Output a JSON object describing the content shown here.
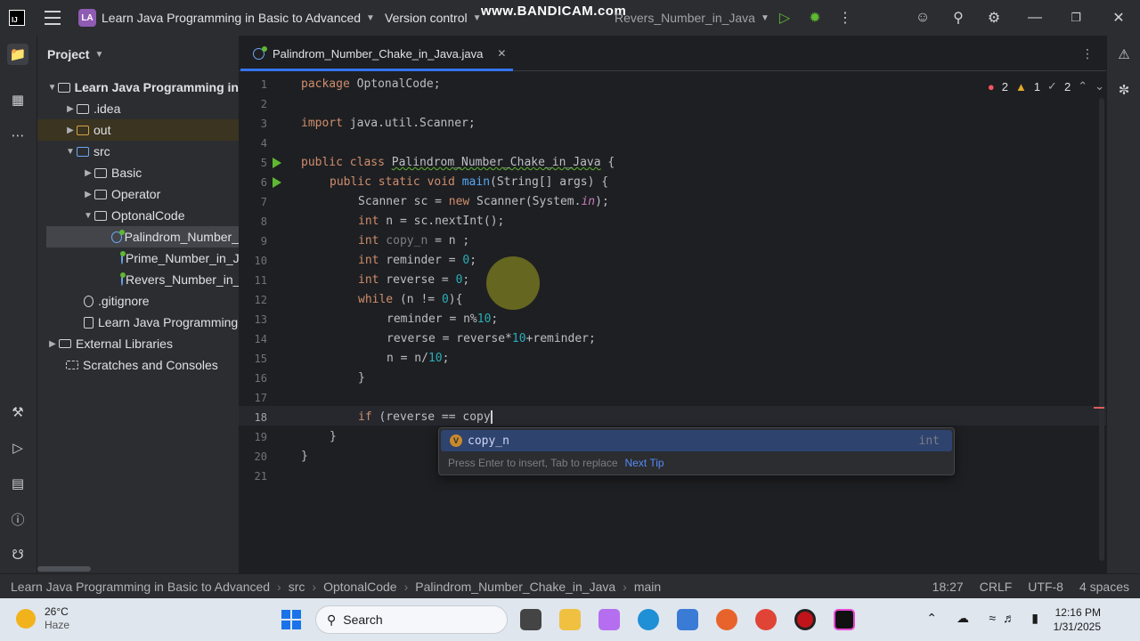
{
  "titlebar": {
    "project_badge": "LA",
    "project_name": "Learn Java Programming in Basic to Advanced",
    "version_control": "Version control",
    "watermark": "www.BANDICAM.com",
    "run_config": "Revers_Number_in_Java"
  },
  "project_panel": {
    "title": "Project",
    "items": [
      {
        "label": "Learn Java Programming in"
      },
      {
        "label": ".idea"
      },
      {
        "label": "out"
      },
      {
        "label": "src"
      },
      {
        "label": "Basic"
      },
      {
        "label": "Operator"
      },
      {
        "label": "OptonalCode"
      },
      {
        "label": "Palindrom_Number_"
      },
      {
        "label": "Prime_Number_in_J"
      },
      {
        "label": "Revers_Number_in_"
      },
      {
        "label": ".gitignore"
      },
      {
        "label": "Learn Java Programming"
      },
      {
        "label": "External Libraries"
      },
      {
        "label": "Scratches and Consoles"
      }
    ]
  },
  "editor": {
    "tab_label": "Palindrom_Number_Chake_in_Java.java",
    "inspection": {
      "errors": "2",
      "warnings": "1",
      "weak": "2"
    },
    "line_numbers": [
      "1",
      "2",
      "3",
      "4",
      "5",
      "6",
      "7",
      "8",
      "9",
      "10",
      "11",
      "12",
      "13",
      "14",
      "15",
      "16",
      "17",
      "18",
      "19",
      "20",
      "21"
    ],
    "code": {
      "l1_kw": "package",
      "l1_rest": " OptonalCode;",
      "l3_kw": "import",
      "l3_rest": " java.util.Scanner;",
      "l5_kw": "public class",
      "l5_name": "Palindrom_Number_Chake_in_Java",
      "l5_rest": " {",
      "l6_kw": "public static void",
      "l6_fn": "main",
      "l6_rest": "(String[] args) {",
      "l7_a": "Scanner sc = ",
      "l7_kw": "new",
      "l7_b": " Scanner(System.",
      "l7_it": "in",
      "l7_c": ");",
      "l8_kw": "int",
      "l8_rest": " n = sc.nextInt();",
      "l9_kw": "int",
      "l9_unused": " copy_n",
      "l9_rest": " = n ;",
      "l10_kw": "int",
      "l10_rest": " reminder = ",
      "l10_num": "0",
      "l10_end": ";",
      "l11_kw": "int",
      "l11_rest": " reverse = ",
      "l11_num": "0",
      "l11_end": ";",
      "l12_kw": "while",
      "l12_rest": " (n != ",
      "l12_num": "0",
      "l12_end": "){",
      "l13_rest": "reminder = n%",
      "l13_num": "10",
      "l13_end": ";",
      "l14_rest": "reverse = reverse*",
      "l14_num": "10",
      "l14_end": "+reminder;",
      "l15_rest": "n = n/",
      "l15_num": "10",
      "l15_end": ";",
      "l16": "}",
      "l18_kw": "if",
      "l18_rest": " (reverse == copy",
      "l19": "}",
      "l20": "}"
    },
    "completion": {
      "item_icon": "V",
      "item_name": "copy_n",
      "item_type": "int",
      "hint": "Press Enter to insert, Tab to replace",
      "next_tip": "Next Tip"
    }
  },
  "statusbar": {
    "crumbs": [
      "Learn Java Programming in Basic to Advanced",
      "src",
      "OptonalCode",
      "Palindrom_Number_Chake_in_Java",
      "main"
    ],
    "position": "18:27",
    "line_sep": "CRLF",
    "encoding": "UTF-8",
    "indent": "4 spaces"
  },
  "taskbar": {
    "temperature": "26°C",
    "weather": "Haze",
    "search_label": "Search",
    "time": "12:16 PM",
    "date": "1/31/2025"
  },
  "colors": {
    "accent": "#3574f0",
    "keyword": "#cf8e6d",
    "number": "#2aacb8",
    "function": "#56a8f5",
    "run_green": "#5fb832"
  }
}
